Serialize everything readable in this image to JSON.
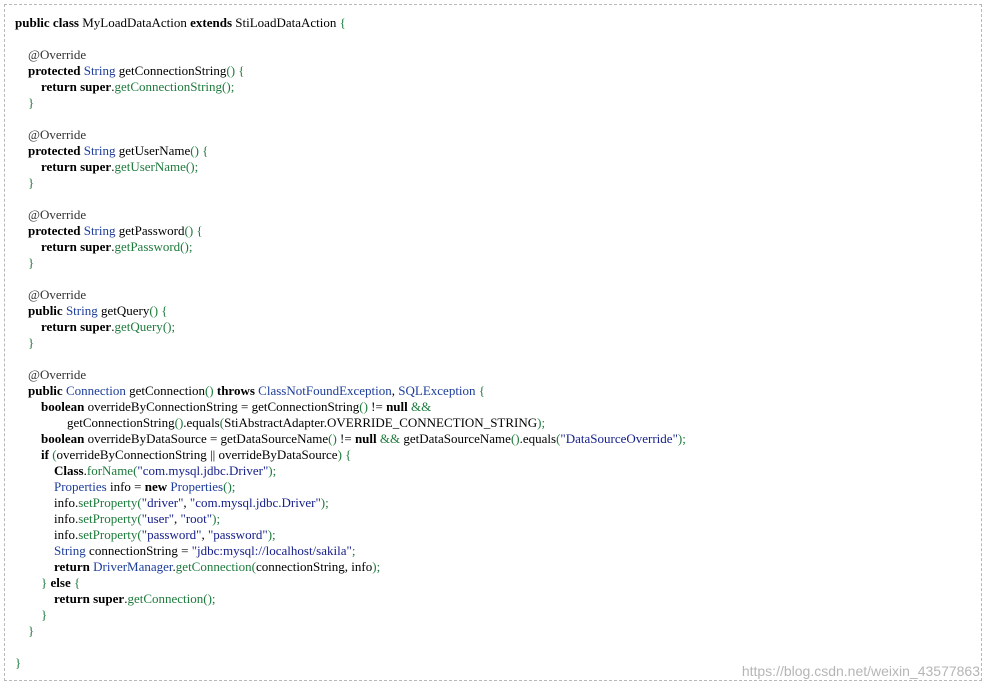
{
  "code": {
    "lines": [
      [
        [
          "kw",
          "public class "
        ],
        [
          "pl",
          "MyLoadDataAction "
        ],
        [
          "kw",
          "extends "
        ],
        [
          "pl",
          "StiLoadDataAction "
        ],
        [
          "pn",
          "{"
        ]
      ],
      [],
      [
        [
          "an",
          "    @Override"
        ]
      ],
      [
        [
          "kw",
          "    protected "
        ],
        [
          "ty",
          "String "
        ],
        [
          "pl",
          "getConnectionString"
        ],
        [
          "pn",
          "() {"
        ]
      ],
      [
        [
          "kw",
          "        return super"
        ],
        [
          "pl",
          "."
        ],
        [
          "fn",
          "getConnectionString"
        ],
        [
          "pn",
          "();"
        ]
      ],
      [
        [
          "pn",
          "    }"
        ]
      ],
      [],
      [
        [
          "an",
          "    @Override"
        ]
      ],
      [
        [
          "kw",
          "    protected "
        ],
        [
          "ty",
          "String "
        ],
        [
          "pl",
          "getUserName"
        ],
        [
          "pn",
          "() {"
        ]
      ],
      [
        [
          "kw",
          "        return super"
        ],
        [
          "pl",
          "."
        ],
        [
          "fn",
          "getUserName"
        ],
        [
          "pn",
          "();"
        ]
      ],
      [
        [
          "pn",
          "    }"
        ]
      ],
      [],
      [
        [
          "an",
          "    @Override"
        ]
      ],
      [
        [
          "kw",
          "    protected "
        ],
        [
          "ty",
          "String "
        ],
        [
          "pl",
          "getPassword"
        ],
        [
          "pn",
          "() {"
        ]
      ],
      [
        [
          "kw",
          "        return super"
        ],
        [
          "pl",
          "."
        ],
        [
          "fn",
          "getPassword"
        ],
        [
          "pn",
          "();"
        ]
      ],
      [
        [
          "pn",
          "    }"
        ]
      ],
      [],
      [
        [
          "an",
          "    @Override"
        ]
      ],
      [
        [
          "kw",
          "    public "
        ],
        [
          "ty",
          "String "
        ],
        [
          "pl",
          "getQuery"
        ],
        [
          "pn",
          "() {"
        ]
      ],
      [
        [
          "kw",
          "        return super"
        ],
        [
          "pl",
          "."
        ],
        [
          "fn",
          "getQuery"
        ],
        [
          "pn",
          "();"
        ]
      ],
      [
        [
          "pn",
          "    }"
        ]
      ],
      [],
      [
        [
          "an",
          "    @Override"
        ]
      ],
      [
        [
          "kw",
          "    public "
        ],
        [
          "ty",
          "Connection "
        ],
        [
          "pl",
          "getConnection"
        ],
        [
          "pn",
          "() "
        ],
        [
          "kw",
          "throws "
        ],
        [
          "ty",
          "ClassNotFoundException"
        ],
        [
          "pl",
          ", "
        ],
        [
          "ty",
          "SQLException "
        ],
        [
          "pn",
          "{"
        ]
      ],
      [
        [
          "kw",
          "        boolean "
        ],
        [
          "pl",
          "overrideByConnectionString = getConnectionString"
        ],
        [
          "pn",
          "() "
        ],
        [
          "pl",
          "!= "
        ],
        [
          "kw",
          "null "
        ],
        [
          "pn",
          "&&"
        ]
      ],
      [
        [
          "pl",
          "                getConnectionString"
        ],
        [
          "pn",
          "()"
        ],
        [
          "pl",
          ".equals"
        ],
        [
          "pn",
          "("
        ],
        [
          "pl",
          "StiAbstractAdapter.OVERRIDE_CONNECTION_STRING"
        ],
        [
          "pn",
          ");"
        ]
      ],
      [
        [
          "kw",
          "        boolean "
        ],
        [
          "pl",
          "overrideByDataSource = getDataSourceName"
        ],
        [
          "pn",
          "() "
        ],
        [
          "pl",
          "!= "
        ],
        [
          "kw",
          "null "
        ],
        [
          "pn",
          "&& "
        ],
        [
          "pl",
          "getDataSourceName"
        ],
        [
          "pn",
          "()"
        ],
        [
          "pl",
          ".equals"
        ],
        [
          "pn",
          "("
        ],
        [
          "st",
          "\"DataSourceOverride\""
        ],
        [
          "pn",
          ");"
        ]
      ],
      [
        [
          "kw",
          "        if "
        ],
        [
          "pn",
          "("
        ],
        [
          "pl",
          "overrideByConnectionString || overrideByDataSource"
        ],
        [
          "pn",
          ") {"
        ]
      ],
      [
        [
          "kw",
          "            Class"
        ],
        [
          "pl",
          "."
        ],
        [
          "fn",
          "forName"
        ],
        [
          "pn",
          "("
        ],
        [
          "st",
          "\"com.mysql.jdbc.Driver\""
        ],
        [
          "pn",
          ");"
        ]
      ],
      [
        [
          "ty",
          "            Properties "
        ],
        [
          "pl",
          "info = "
        ],
        [
          "kw",
          "new "
        ],
        [
          "ty",
          "Properties"
        ],
        [
          "pn",
          "();"
        ]
      ],
      [
        [
          "pl",
          "            info."
        ],
        [
          "fn",
          "setProperty"
        ],
        [
          "pn",
          "("
        ],
        [
          "st",
          "\"driver\""
        ],
        [
          "pl",
          ", "
        ],
        [
          "st",
          "\"com.mysql.jdbc.Driver\""
        ],
        [
          "pn",
          ");"
        ]
      ],
      [
        [
          "pl",
          "            info."
        ],
        [
          "fn",
          "setProperty"
        ],
        [
          "pn",
          "("
        ],
        [
          "st",
          "\"user\""
        ],
        [
          "pl",
          ", "
        ],
        [
          "st",
          "\"root\""
        ],
        [
          "pn",
          ");"
        ]
      ],
      [
        [
          "pl",
          "            info."
        ],
        [
          "fn",
          "setProperty"
        ],
        [
          "pn",
          "("
        ],
        [
          "st",
          "\"password\""
        ],
        [
          "pl",
          ", "
        ],
        [
          "st",
          "\"password\""
        ],
        [
          "pn",
          ");"
        ]
      ],
      [
        [
          "ty",
          "            String "
        ],
        [
          "pl",
          "connectionString = "
        ],
        [
          "st",
          "\"jdbc:mysql://localhost/sakila\""
        ],
        [
          "pn",
          ";"
        ]
      ],
      [
        [
          "kw",
          "            return "
        ],
        [
          "ty",
          "DriverManager"
        ],
        [
          "pl",
          "."
        ],
        [
          "fn",
          "getConnection"
        ],
        [
          "pn",
          "("
        ],
        [
          "pl",
          "connectionString, info"
        ],
        [
          "pn",
          ");"
        ]
      ],
      [
        [
          "pn",
          "        } "
        ],
        [
          "kw",
          "else "
        ],
        [
          "pn",
          "{"
        ]
      ],
      [
        [
          "kw",
          "            return super"
        ],
        [
          "pl",
          "."
        ],
        [
          "fn",
          "getConnection"
        ],
        [
          "pn",
          "();"
        ]
      ],
      [
        [
          "pn",
          "        }"
        ]
      ],
      [
        [
          "pn",
          "    }"
        ]
      ],
      [],
      [
        [
          "pn",
          "}"
        ]
      ]
    ]
  },
  "watermark": "https://blog.csdn.net/weixin_43577863"
}
